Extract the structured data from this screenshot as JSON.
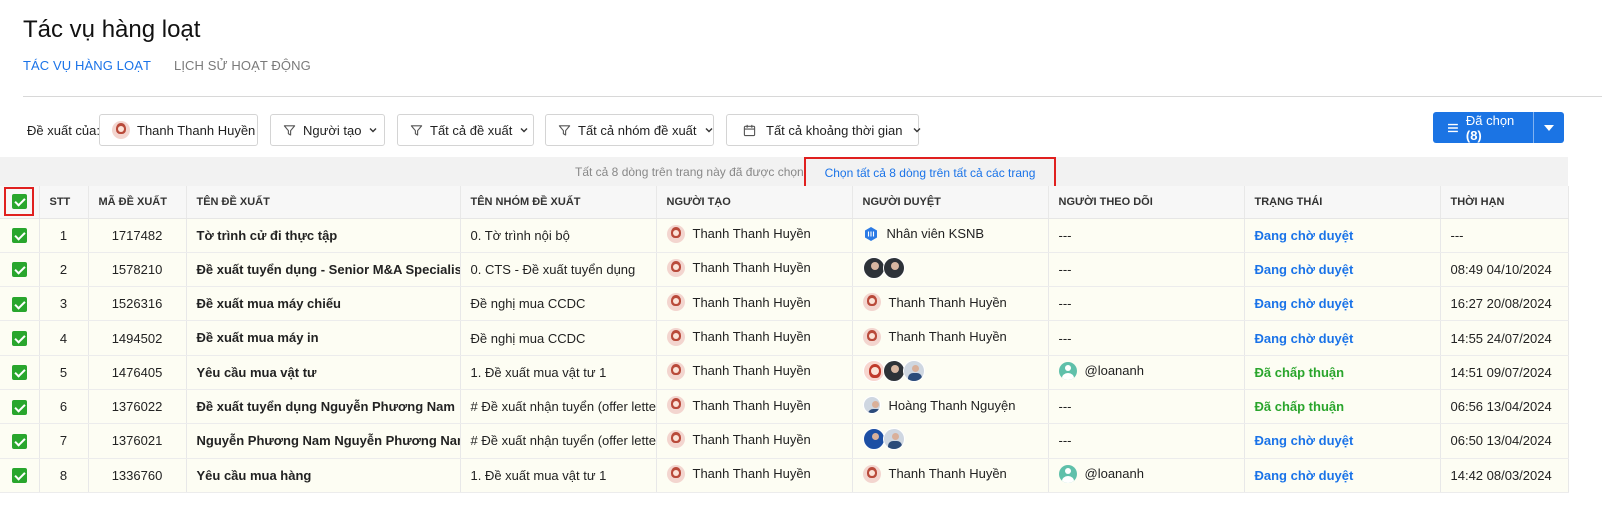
{
  "page_title": "Tác vụ hàng loạt",
  "tabs": [
    {
      "label": "TÁC VỤ HÀNG LOẠT",
      "active": true
    },
    {
      "label": "LỊCH SỬ HOẠT ĐỘNG",
      "active": false
    }
  ],
  "filters": {
    "label": "Đề xuất của:",
    "owner": "Thanh Thanh Huyền",
    "creator": "Người tạo",
    "all_proposals": "Tất cả đề xuất",
    "all_groups": "Tất cả nhóm đề xuất",
    "all_time": "Tất cả khoảng thời gian"
  },
  "selected_button": {
    "label": "Đã chọn",
    "count": "(8)"
  },
  "banner": {
    "text": "Tất cả 8 dòng trên trang này đã được chọn",
    "link": "Chọn tất cả 8 dòng trên tất cả các trang"
  },
  "columns": [
    "STT",
    "MÃ ĐỀ XUẤT",
    "TÊN ĐỀ XUẤT",
    "TÊN NHÓM ĐỀ XUẤT",
    "NGƯỜI TẠO",
    "NGƯỜI DUYỆT",
    "NGƯỜI THEO DÕI",
    "TRẠNG THÁI",
    "THỜI HẠN"
  ],
  "rows": [
    {
      "stt": "1",
      "code": "1717482",
      "name": "Tờ trình cử đi thực tập",
      "group": "0. Tờ trình nội bộ",
      "creator": "Thanh Thanh Huyền",
      "approver": "Nhân viên KSNB",
      "follower": "---",
      "status": "Đang chờ duyệt",
      "deadline": "---"
    },
    {
      "stt": "2",
      "code": "1578210",
      "name": "Đề xuất tuyển dụng - Senior M&A Specialist",
      "group": "0. CTS - Đề xuất tuyển dụng",
      "creator": "Thanh Thanh Huyền",
      "approver": "",
      "follower": "---",
      "status": "Đang chờ duyệt",
      "deadline": "08:49 04/10/2024"
    },
    {
      "stt": "3",
      "code": "1526316",
      "name": "Đề xuất mua máy chiếu",
      "group": "Đề nghị mua CCDC",
      "creator": "Thanh Thanh Huyền",
      "approver": "Thanh Thanh Huyền",
      "follower": "---",
      "status": "Đang chờ duyệt",
      "deadline": "16:27 20/08/2024"
    },
    {
      "stt": "4",
      "code": "1494502",
      "name": "Đề xuất mua máy in",
      "group": "Đề nghị mua CCDC",
      "creator": "Thanh Thanh Huyền",
      "approver": "Thanh Thanh Huyền",
      "follower": "---",
      "status": "Đang chờ duyệt",
      "deadline": "14:55 24/07/2024"
    },
    {
      "stt": "5",
      "code": "1476405",
      "name": "Yêu cầu mua vật tư",
      "group": "1. Đề xuất mua vật tư 1",
      "creator": "Thanh Thanh Huyền",
      "approver": "",
      "follower": "@loananh",
      "status": "Đã chấp thuận",
      "deadline": "14:51 09/07/2024"
    },
    {
      "stt": "6",
      "code": "1376022",
      "name": "Đề xuất tuyển dụng Nguyễn Phương Nam",
      "group": "# Đề xuất nhận tuyển (offer letter)",
      "creator": "Thanh Thanh Huyền",
      "approver": "Hoàng Thanh Nguyện",
      "follower": "---",
      "status": "Đã chấp thuận",
      "deadline": "06:56 13/04/2024"
    },
    {
      "stt": "7",
      "code": "1376021",
      "name": "Nguyễn Phương Nam Nguyễn Phương Nam",
      "group": "# Đề xuất nhận tuyển (offer letter)",
      "creator": "Thanh Thanh Huyền",
      "approver": "",
      "follower": "---",
      "status": "Đang chờ duyệt",
      "deadline": "06:50 13/04/2024"
    },
    {
      "stt": "8",
      "code": "1336760",
      "name": "Yêu cầu mua hàng",
      "group": "1. Đề xuất mua vật tư 1",
      "creator": "Thanh Thanh Huyền",
      "approver": "Thanh Thanh Huyền",
      "follower": "@loananh",
      "status": "Đang chờ duyệt",
      "deadline": "14:42 08/03/2024"
    }
  ],
  "colors": {
    "primary": "#1b74e4",
    "pending": "#1a73e8",
    "approved": "#2aa52c",
    "highlight": "#e0201f",
    "checkbox": "#29a62d"
  }
}
